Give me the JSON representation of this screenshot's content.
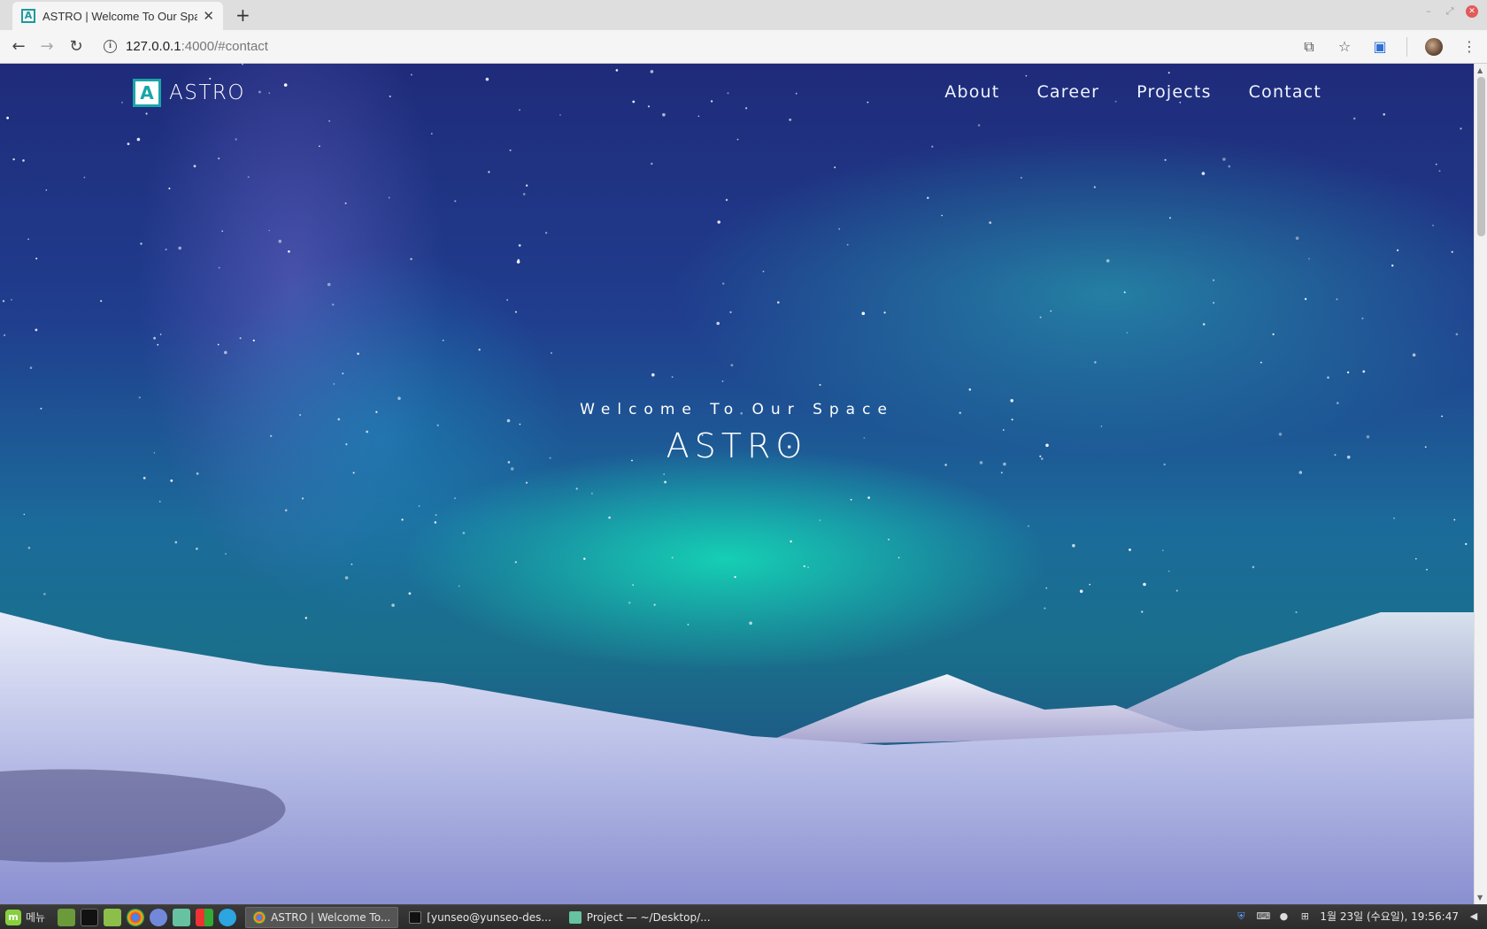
{
  "browser": {
    "tab_title": "ASTRO | Welcome To Our Space",
    "tab_favicon_letter": "A",
    "new_tab_symbol": "+",
    "url_host": "127.0.0.1",
    "url_rest": ":4000/#contact"
  },
  "site": {
    "logo_letter": "A",
    "logo_text": "ASTRO",
    "nav": [
      "About",
      "Career",
      "Projects",
      "Contact"
    ],
    "hero_subtitle": "Welcome To Our Space",
    "hero_title": "ASTRO",
    "accent_color": "#1aa5a8"
  },
  "taskbar": {
    "menu_label": "메뉴",
    "tasks": [
      {
        "label": "ASTRO | Welcome To...",
        "icon": "chrome-icon",
        "active": true
      },
      {
        "label": "[yunseo@yunseo-des...",
        "icon": "terminal-icon",
        "active": false
      },
      {
        "label": "Project — ~/Desktop/...",
        "icon": "atom-icon",
        "active": false
      }
    ],
    "clock": "1월 23일 (수요일), 19:56:47"
  }
}
